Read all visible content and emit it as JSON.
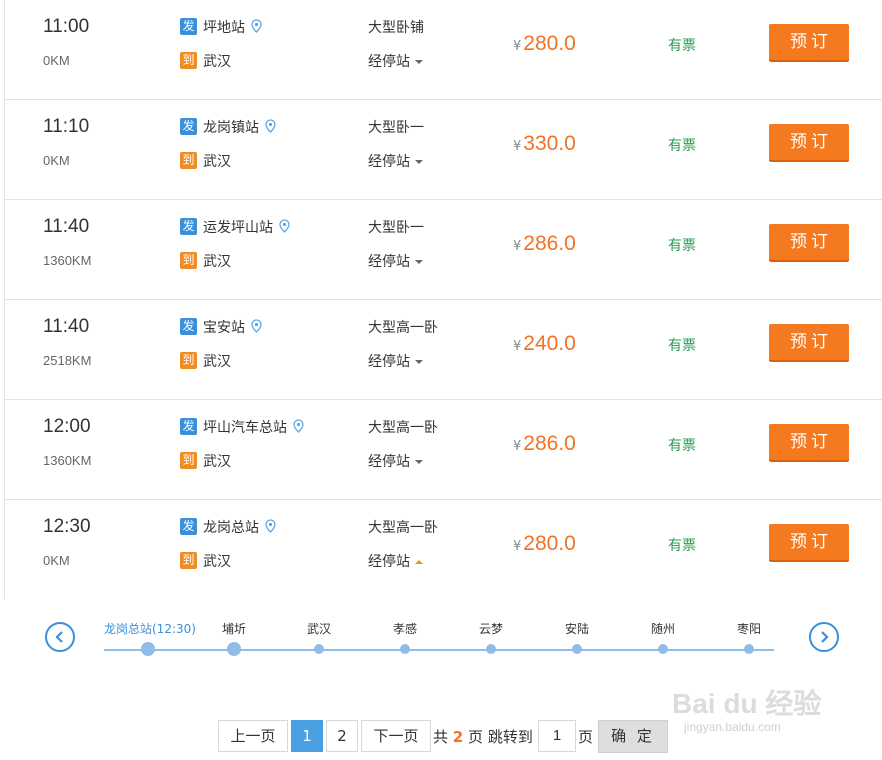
{
  "trips": [
    {
      "time": "11:00",
      "distance": "0KM",
      "depart_tag": "发",
      "arrive_tag": "到",
      "from": "坪地站",
      "to": "武汉",
      "bus_type": "大型卧铺",
      "stops_label": "经停站",
      "price_symbol": "¥",
      "price": "280.0",
      "availability": "有票",
      "book_label": "预订"
    },
    {
      "time": "11:10",
      "distance": "0KM",
      "depart_tag": "发",
      "arrive_tag": "到",
      "from": "龙岗镇站",
      "to": "武汉",
      "bus_type": "大型卧一",
      "stops_label": "经停站",
      "price_symbol": "¥",
      "price": "330.0",
      "availability": "有票",
      "book_label": "预订"
    },
    {
      "time": "11:40",
      "distance": "1360KM",
      "depart_tag": "发",
      "arrive_tag": "到",
      "from": "运发坪山站",
      "to": "武汉",
      "bus_type": "大型卧一",
      "stops_label": "经停站",
      "price_symbol": "¥",
      "price": "286.0",
      "availability": "有票",
      "book_label": "预订"
    },
    {
      "time": "11:40",
      "distance": "2518KM",
      "depart_tag": "发",
      "arrive_tag": "到",
      "from": "宝安站",
      "to": "武汉",
      "bus_type": "大型高一卧",
      "stops_label": "经停站",
      "price_symbol": "¥",
      "price": "240.0",
      "availability": "有票",
      "book_label": "预订"
    },
    {
      "time": "12:00",
      "distance": "1360KM",
      "depart_tag": "发",
      "arrive_tag": "到",
      "from": "坪山汽车总站",
      "to": "武汉",
      "bus_type": "大型高一卧",
      "stops_label": "经停站",
      "price_symbol": "¥",
      "price": "286.0",
      "availability": "有票",
      "book_label": "预订"
    },
    {
      "time": "12:30",
      "distance": "0KM",
      "depart_tag": "发",
      "arrive_tag": "到",
      "from": "龙岗总站",
      "to": "武汉",
      "bus_type": "大型高一卧",
      "stops_label": "经停站",
      "price_symbol": "¥",
      "price": "280.0",
      "availability": "有票",
      "book_label": "预订",
      "expanded": true
    }
  ],
  "stops_timeline": {
    "stops": [
      "龙岗总站(12:30)",
      "埔圻",
      "武汉",
      "孝感",
      "云梦",
      "安陆",
      "随州",
      "枣阳"
    ]
  },
  "pagination": {
    "prev_label": "上一页",
    "pages": [
      "1",
      "2"
    ],
    "current_page": "1",
    "next_label": "下一页",
    "total_prefix": "共",
    "total_pages": "2",
    "total_suffix": "页",
    "jump_label": "跳转到",
    "jump_value": "1",
    "jump_suffix": "页",
    "confirm_label": "确 定"
  },
  "watermark": {
    "logo": "Bai du 经验",
    "url": "jingyan.baidu.com"
  },
  "colors": {
    "accent_orange": "#f4791f",
    "price_orange": "#f27222",
    "depart_blue": "#3d8fd9",
    "arrive_orange": "#f08c24",
    "available_green": "#2a9b4f",
    "timeline_blue": "#8fbde8"
  },
  "icons": {
    "location": "map-pin-icon",
    "stops_toggle": "caret-icon",
    "prev": "chevron-left-icon",
    "next": "chevron-right-icon"
  }
}
